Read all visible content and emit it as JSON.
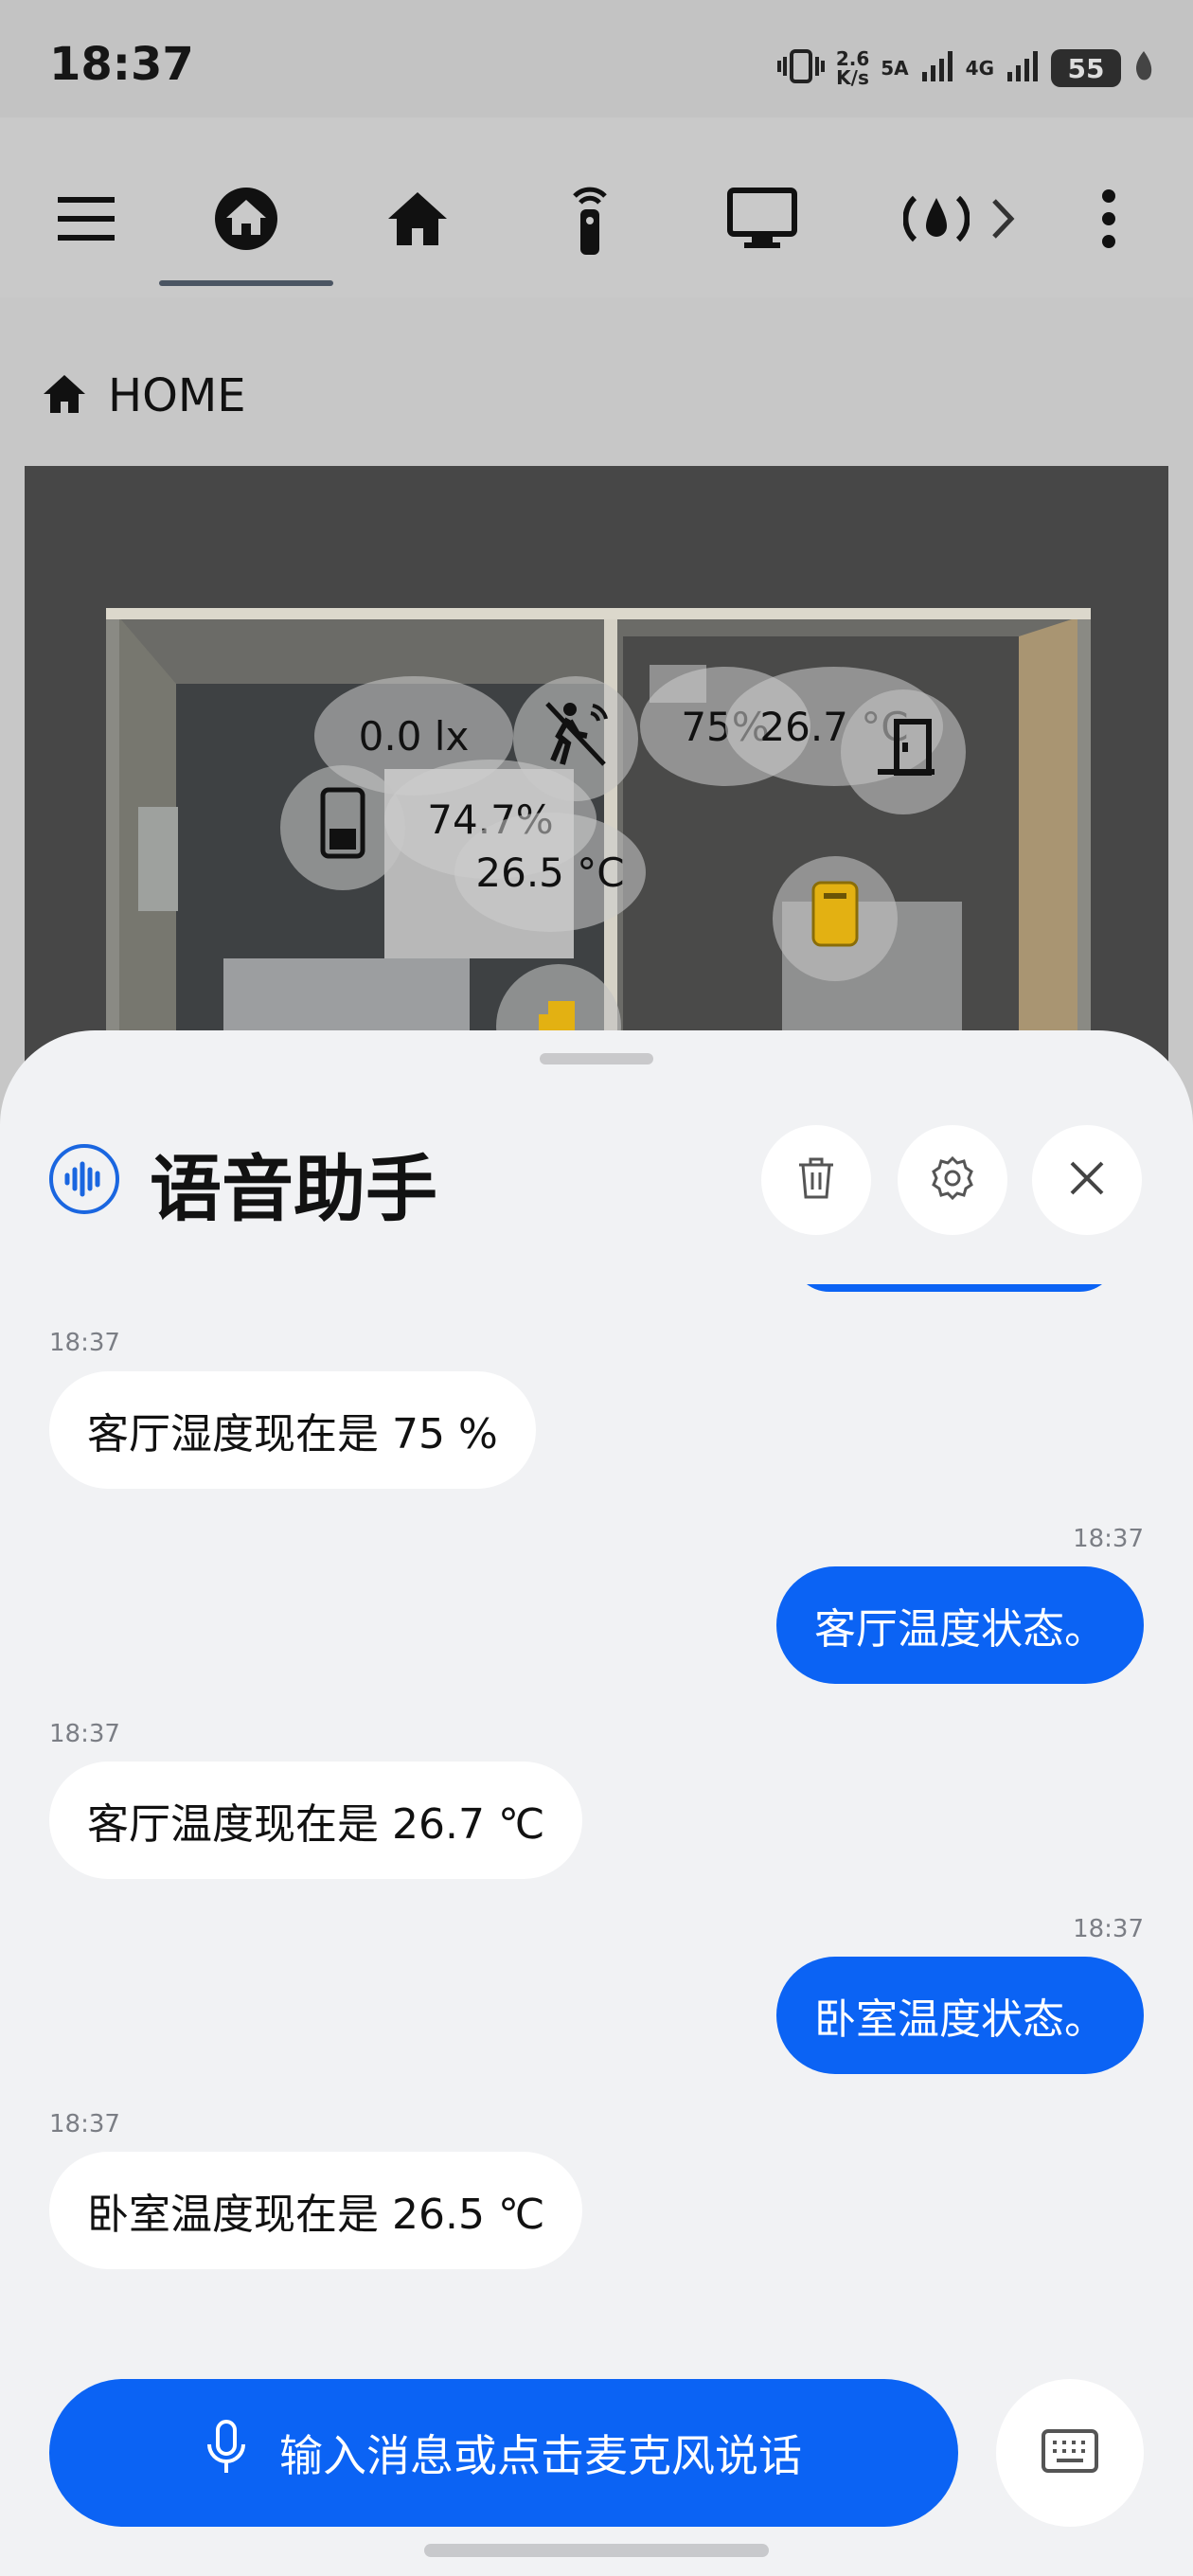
{
  "status_bar": {
    "time": "18:37",
    "net_speed_value": "2.6",
    "net_speed_unit": "K/s",
    "sim1": "5A",
    "sim2": "4G",
    "battery": "55"
  },
  "app_bar": {
    "tabs": [
      {
        "icon": "home-circle-icon",
        "selected": true
      },
      {
        "icon": "home-icon"
      },
      {
        "icon": "remote-icon"
      },
      {
        "icon": "monitor-icon"
      },
      {
        "icon": "water-drop-icon"
      }
    ]
  },
  "breadcrumb": {
    "label": "HOME"
  },
  "floorplan": {
    "lux": "0.0 lx",
    "humidity_right": "75%",
    "temp_right": "26.7 °C",
    "humidity_left": "74.7%",
    "temp_left": "26.5 °C"
  },
  "assistant": {
    "title": "语音助手",
    "messages": [
      {
        "role": "bot",
        "time": "18:37",
        "text": "客厅湿度现在是 75 %"
      },
      {
        "role": "user",
        "time": "18:37",
        "text": "客厅温度状态。"
      },
      {
        "role": "bot",
        "time": "18:37",
        "text": "客厅温度现在是 26.7 ℃"
      },
      {
        "role": "user",
        "time": "18:37",
        "text": "卧室温度状态。"
      },
      {
        "role": "bot",
        "time": "18:37",
        "text": "卧室温度现在是 26.5 ℃"
      }
    ],
    "input_placeholder": "输入消息或点击麦克风说话"
  },
  "colors": {
    "accent": "#0b63f4",
    "sensor_yellow": "#e3b112"
  }
}
